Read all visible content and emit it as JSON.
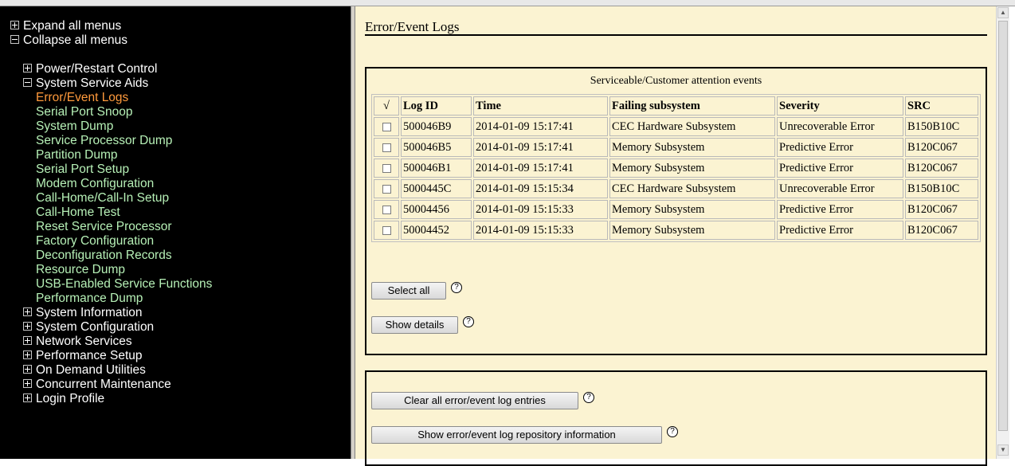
{
  "nav": {
    "expand_all": "Expand all menus",
    "collapse_all": "Collapse all menus",
    "power_restart": "Power/Restart Control",
    "system_service_aids": "System Service Aids",
    "service_aids_items": [
      "Error/Event Logs",
      "Serial Port Snoop",
      "System Dump",
      "Service Processor Dump",
      "Partition Dump",
      "Serial Port Setup",
      "Modem Configuration",
      "Call-Home/Call-In Setup",
      "Call-Home Test",
      "Reset Service Processor",
      "Factory Configuration",
      "Deconfiguration Records",
      "Resource Dump",
      "USB-Enabled Service Functions",
      "Performance Dump"
    ],
    "other_menus": [
      "System Information",
      "System Configuration",
      "Network Services",
      "Performance Setup",
      "On Demand Utilities",
      "Concurrent Maintenance",
      "Login Profile"
    ]
  },
  "page": {
    "title": "Error/Event Logs",
    "events_caption": "Serviceable/Customer attention events",
    "table": {
      "check_header": "√",
      "columns": [
        "Log ID",
        "Time",
        "Failing subsystem",
        "Severity",
        "SRC"
      ],
      "rows": [
        [
          "500046B9",
          "2014-01-09 15:17:41",
          "CEC Hardware Subsystem",
          "Unrecoverable Error",
          "B150B10C"
        ],
        [
          "500046B5",
          "2014-01-09 15:17:41",
          "Memory Subsystem",
          "Predictive Error",
          "B120C067"
        ],
        [
          "500046B1",
          "2014-01-09 15:17:41",
          "Memory Subsystem",
          "Predictive Error",
          "B120C067"
        ],
        [
          "5000445C",
          "2014-01-09 15:15:34",
          "CEC Hardware Subsystem",
          "Unrecoverable Error",
          "B150B10C"
        ],
        [
          "50004456",
          "2014-01-09 15:15:33",
          "Memory Subsystem",
          "Predictive Error",
          "B120C067"
        ],
        [
          "50004452",
          "2014-01-09 15:15:33",
          "Memory Subsystem",
          "Predictive Error",
          "B120C067"
        ]
      ]
    },
    "buttons": {
      "select_all": "Select all",
      "show_details": "Show details",
      "clear_all": "Clear all error/event log entries",
      "show_repository": "Show error/event log repository information"
    },
    "help_glyph": "?"
  },
  "colors": {
    "nav_background": "#000000",
    "nav_link": "#b6f0b6",
    "nav_active": "#ff9a3c",
    "content_background": "#fbf3d2"
  }
}
